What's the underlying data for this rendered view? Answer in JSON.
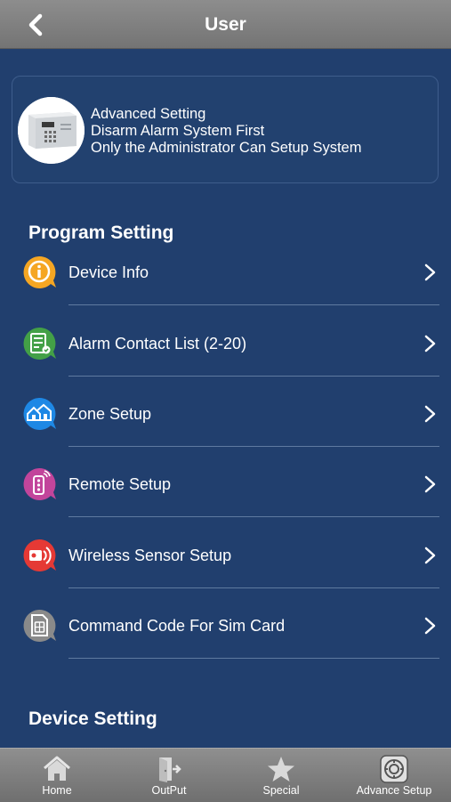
{
  "header": {
    "title": "User",
    "back_icon": "chevron-left-icon"
  },
  "info_card": {
    "line1": "Advanced Setting",
    "line2": "Disarm Alarm System First",
    "line3": "Only the Administrator Can Setup System"
  },
  "program_setting": {
    "title": "Program Setting",
    "items": [
      {
        "label": "Device Info",
        "icon": "info-icon",
        "color": "#f5a623"
      },
      {
        "label": "Alarm Contact List (2-20)",
        "icon": "contact-list-icon",
        "color": "#4caf50"
      },
      {
        "label": "Zone Setup",
        "icon": "zone-house-icon",
        "color": "#1e88e5"
      },
      {
        "label": "Remote Setup",
        "icon": "remote-control-icon",
        "color": "#c2459b"
      },
      {
        "label": "Wireless Sensor Setup",
        "icon": "wireless-sensor-icon",
        "color": "#e53935"
      },
      {
        "label": "Command Code For Sim Card",
        "icon": "sim-card-icon",
        "color": "#8a8a8a"
      }
    ]
  },
  "device_setting": {
    "title": "Device Setting"
  },
  "tabbar": {
    "items": [
      {
        "label": "Home",
        "icon": "home-icon"
      },
      {
        "label": "OutPut",
        "icon": "output-door-icon"
      },
      {
        "label": "Special",
        "icon": "star-icon"
      },
      {
        "label": "Advance Setup",
        "icon": "advance-setup-icon"
      }
    ]
  }
}
